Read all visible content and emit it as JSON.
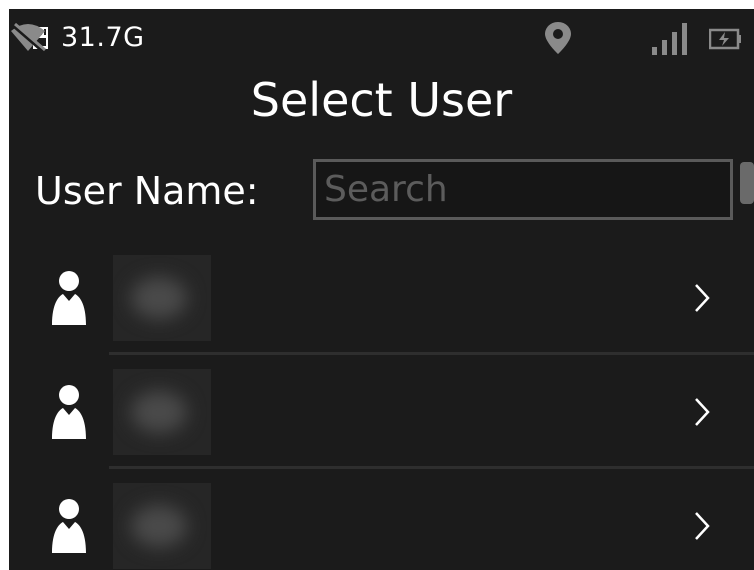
{
  "status_bar": {
    "storage": "31.7G",
    "icons": [
      "sd-card-icon",
      "location-pin-icon",
      "wifi-off-icon",
      "signal-icon",
      "battery-charging-icon"
    ]
  },
  "title": "Select User",
  "search": {
    "label": "User Name:",
    "placeholder": "Search",
    "value": ""
  },
  "users": [
    {
      "name_redacted": true,
      "icon": "user-icon",
      "chevron": "chevron-right-icon"
    },
    {
      "name_redacted": true,
      "icon": "user-icon",
      "chevron": "chevron-right-icon"
    },
    {
      "name_redacted": true,
      "icon": "user-icon",
      "chevron": "chevron-right-icon"
    }
  ],
  "colors": {
    "background": "#1b1b1b",
    "text": "#ffffff",
    "input_border": "#5a5a5a",
    "placeholder": "#5c5c5c",
    "divider": "#2e2e2e",
    "status_icon_dim": "#8a8a8a"
  }
}
